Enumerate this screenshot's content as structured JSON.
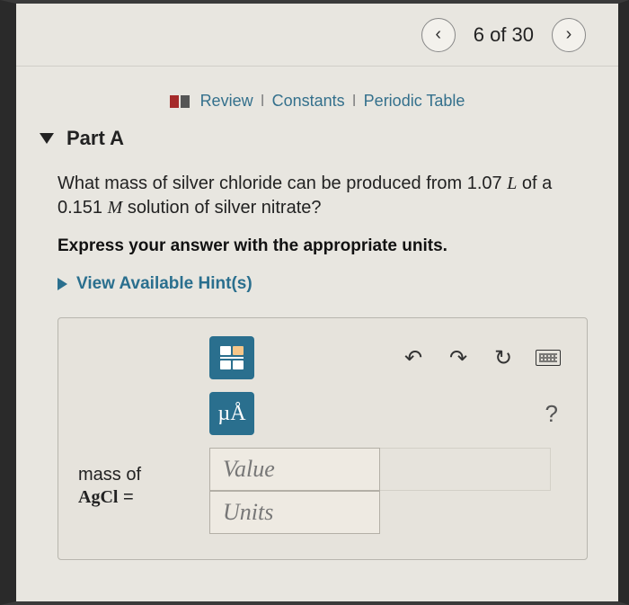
{
  "nav": {
    "prev_glyph": "‹",
    "count_text": "6 of 30",
    "next_glyph": "›"
  },
  "resources": {
    "review": "Review",
    "constants": "Constants",
    "periodic": "Periodic Table"
  },
  "part": {
    "label": "Part A"
  },
  "question": {
    "pre": "What mass of silver chloride can be produced from 1.07 ",
    "L": "L",
    "mid": " of a 0.151 ",
    "M": "M",
    "post": " solution of silver nitrate?"
  },
  "instruction": "Express your answer with the appropriate units.",
  "hints": {
    "label": "View Available Hint(s)"
  },
  "toolbar": {
    "mua": "µÅ",
    "undo": "↶",
    "redo": "↷",
    "reset": "↻",
    "help": "?"
  },
  "answer": {
    "var_line1": "mass of",
    "var_line2_chem": "AgCl",
    "var_line2_eq": " =",
    "value_placeholder": "Value",
    "units_placeholder": "Units"
  }
}
